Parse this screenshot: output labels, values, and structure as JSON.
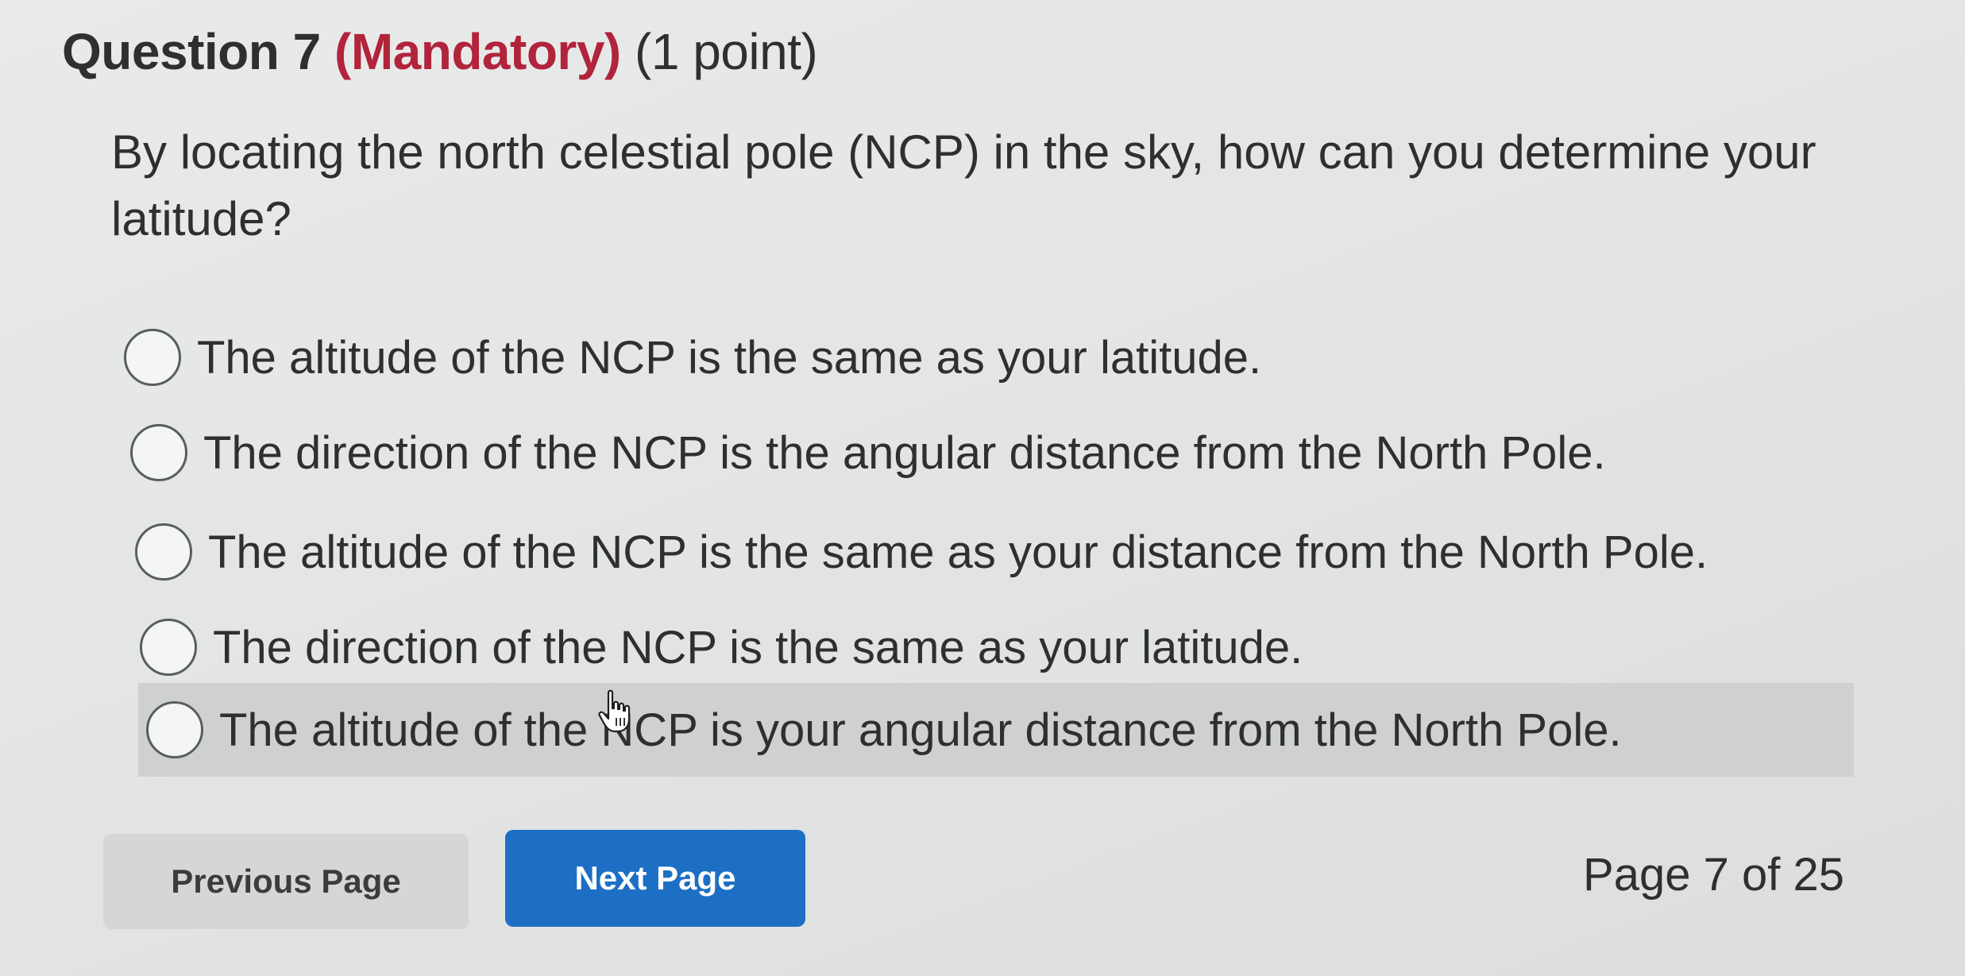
{
  "question": {
    "number_label": "Question 7",
    "mandatory_label": "(Mandatory)",
    "points_label": "(1 point)",
    "text": "By locating the north celestial pole (NCP) in the sky, how can you determine your latitude?"
  },
  "options": [
    {
      "label": "The altitude of the NCP is the same as your latitude."
    },
    {
      "label": "The direction of the NCP is the angular distance from the North Pole."
    },
    {
      "label": "The altitude of the NCP is the same as your distance from the North Pole."
    },
    {
      "label": "The direction of the NCP is the same as your latitude."
    },
    {
      "label": "The altitude of the NCP is your angular distance from the North Pole."
    }
  ],
  "navigation": {
    "previous_label": "Previous Page",
    "next_label": "Next Page",
    "page_indicator": "Page 7 of 25"
  },
  "colors": {
    "mandatory": "#b1243c",
    "next_button": "#1c6fc4",
    "previous_button": "#d4d6d7",
    "hover_row": "#cfd1d0"
  },
  "icons": {
    "cursor": "hand-pointer-icon"
  }
}
